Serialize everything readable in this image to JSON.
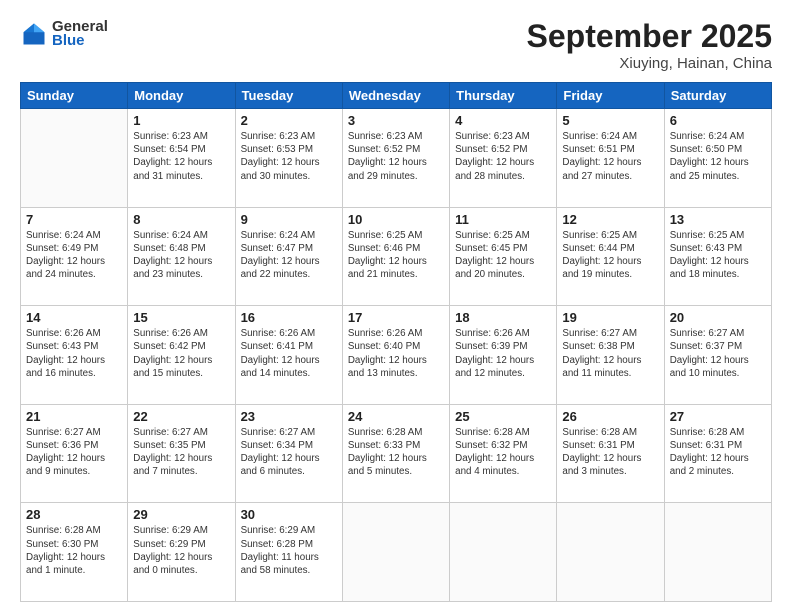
{
  "header": {
    "logo_general": "General",
    "logo_blue": "Blue",
    "title": "September 2025",
    "location": "Xiuying, Hainan, China"
  },
  "columns": [
    "Sunday",
    "Monday",
    "Tuesday",
    "Wednesday",
    "Thursday",
    "Friday",
    "Saturday"
  ],
  "weeks": [
    [
      {
        "day": "",
        "info": ""
      },
      {
        "day": "1",
        "info": "Sunrise: 6:23 AM\nSunset: 6:54 PM\nDaylight: 12 hours\nand 31 minutes."
      },
      {
        "day": "2",
        "info": "Sunrise: 6:23 AM\nSunset: 6:53 PM\nDaylight: 12 hours\nand 30 minutes."
      },
      {
        "day": "3",
        "info": "Sunrise: 6:23 AM\nSunset: 6:52 PM\nDaylight: 12 hours\nand 29 minutes."
      },
      {
        "day": "4",
        "info": "Sunrise: 6:23 AM\nSunset: 6:52 PM\nDaylight: 12 hours\nand 28 minutes."
      },
      {
        "day": "5",
        "info": "Sunrise: 6:24 AM\nSunset: 6:51 PM\nDaylight: 12 hours\nand 27 minutes."
      },
      {
        "day": "6",
        "info": "Sunrise: 6:24 AM\nSunset: 6:50 PM\nDaylight: 12 hours\nand 25 minutes."
      }
    ],
    [
      {
        "day": "7",
        "info": "Sunrise: 6:24 AM\nSunset: 6:49 PM\nDaylight: 12 hours\nand 24 minutes."
      },
      {
        "day": "8",
        "info": "Sunrise: 6:24 AM\nSunset: 6:48 PM\nDaylight: 12 hours\nand 23 minutes."
      },
      {
        "day": "9",
        "info": "Sunrise: 6:24 AM\nSunset: 6:47 PM\nDaylight: 12 hours\nand 22 minutes."
      },
      {
        "day": "10",
        "info": "Sunrise: 6:25 AM\nSunset: 6:46 PM\nDaylight: 12 hours\nand 21 minutes."
      },
      {
        "day": "11",
        "info": "Sunrise: 6:25 AM\nSunset: 6:45 PM\nDaylight: 12 hours\nand 20 minutes."
      },
      {
        "day": "12",
        "info": "Sunrise: 6:25 AM\nSunset: 6:44 PM\nDaylight: 12 hours\nand 19 minutes."
      },
      {
        "day": "13",
        "info": "Sunrise: 6:25 AM\nSunset: 6:43 PM\nDaylight: 12 hours\nand 18 minutes."
      }
    ],
    [
      {
        "day": "14",
        "info": "Sunrise: 6:26 AM\nSunset: 6:43 PM\nDaylight: 12 hours\nand 16 minutes."
      },
      {
        "day": "15",
        "info": "Sunrise: 6:26 AM\nSunset: 6:42 PM\nDaylight: 12 hours\nand 15 minutes."
      },
      {
        "day": "16",
        "info": "Sunrise: 6:26 AM\nSunset: 6:41 PM\nDaylight: 12 hours\nand 14 minutes."
      },
      {
        "day": "17",
        "info": "Sunrise: 6:26 AM\nSunset: 6:40 PM\nDaylight: 12 hours\nand 13 minutes."
      },
      {
        "day": "18",
        "info": "Sunrise: 6:26 AM\nSunset: 6:39 PM\nDaylight: 12 hours\nand 12 minutes."
      },
      {
        "day": "19",
        "info": "Sunrise: 6:27 AM\nSunset: 6:38 PM\nDaylight: 12 hours\nand 11 minutes."
      },
      {
        "day": "20",
        "info": "Sunrise: 6:27 AM\nSunset: 6:37 PM\nDaylight: 12 hours\nand 10 minutes."
      }
    ],
    [
      {
        "day": "21",
        "info": "Sunrise: 6:27 AM\nSunset: 6:36 PM\nDaylight: 12 hours\nand 9 minutes."
      },
      {
        "day": "22",
        "info": "Sunrise: 6:27 AM\nSunset: 6:35 PM\nDaylight: 12 hours\nand 7 minutes."
      },
      {
        "day": "23",
        "info": "Sunrise: 6:27 AM\nSunset: 6:34 PM\nDaylight: 12 hours\nand 6 minutes."
      },
      {
        "day": "24",
        "info": "Sunrise: 6:28 AM\nSunset: 6:33 PM\nDaylight: 12 hours\nand 5 minutes."
      },
      {
        "day": "25",
        "info": "Sunrise: 6:28 AM\nSunset: 6:32 PM\nDaylight: 12 hours\nand 4 minutes."
      },
      {
        "day": "26",
        "info": "Sunrise: 6:28 AM\nSunset: 6:31 PM\nDaylight: 12 hours\nand 3 minutes."
      },
      {
        "day": "27",
        "info": "Sunrise: 6:28 AM\nSunset: 6:31 PM\nDaylight: 12 hours\nand 2 minutes."
      }
    ],
    [
      {
        "day": "28",
        "info": "Sunrise: 6:28 AM\nSunset: 6:30 PM\nDaylight: 12 hours\nand 1 minute."
      },
      {
        "day": "29",
        "info": "Sunrise: 6:29 AM\nSunset: 6:29 PM\nDaylight: 12 hours\nand 0 minutes."
      },
      {
        "day": "30",
        "info": "Sunrise: 6:29 AM\nSunset: 6:28 PM\nDaylight: 11 hours\nand 58 minutes."
      },
      {
        "day": "",
        "info": ""
      },
      {
        "day": "",
        "info": ""
      },
      {
        "day": "",
        "info": ""
      },
      {
        "day": "",
        "info": ""
      }
    ]
  ]
}
